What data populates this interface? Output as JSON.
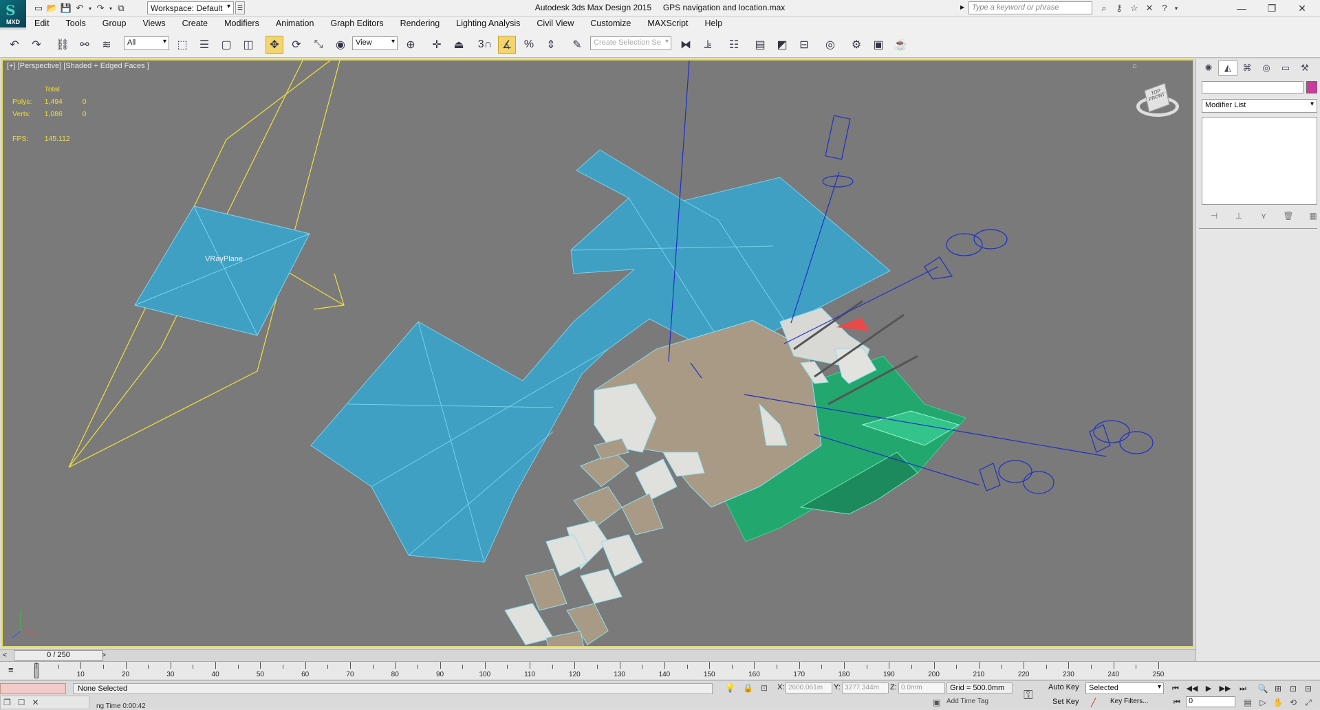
{
  "app": {
    "title": "Autodesk 3ds Max Design 2015",
    "file": "GPS navigation and location.max",
    "logo_text": "MXD",
    "workspace": "Workspace: Default",
    "search_placeholder": "Type a keyword or phrase"
  },
  "menu": [
    "Edit",
    "Tools",
    "Group",
    "Views",
    "Create",
    "Modifiers",
    "Animation",
    "Graph Editors",
    "Rendering",
    "Lighting Analysis",
    "Civil View",
    "Customize",
    "MAXScript",
    "Help"
  ],
  "toolbar": {
    "filter_select": "All",
    "coord_select": "View",
    "selection_set": "Create Selection Se",
    "snap_label": "3"
  },
  "viewport": {
    "label": "[+] [Perspective] [Shaded + Edged Faces ]",
    "stats": {
      "header": "Total",
      "polys_label": "Polys:",
      "polys_value": "1,494",
      "polys_sel": "0",
      "verts_label": "Verts:",
      "verts_value": "1,086",
      "verts_sel": "0",
      "fps_label": "FPS:",
      "fps_value": "145.112"
    },
    "object_label": "VRayPlane",
    "viewcube_top": "TOP",
    "viewcube_front": "FRONT",
    "colors": {
      "background": "#7a7a7a",
      "plane_blue": "#3fa0c4",
      "green_area": "#22a86f",
      "building": "#a89a84",
      "light_building": "#e0e0dc",
      "camera_blue": "#1e2fc8",
      "light_yellow": "#f3e23a",
      "target_red": "#e84a4a",
      "active_border": "#e9e043"
    }
  },
  "command_panel": {
    "modifier_list": "Modifier List",
    "object_color": "#cc3aa0"
  },
  "time": {
    "frame_display": "0 / 250",
    "ruler_labels": [
      "0",
      "10",
      "20",
      "30",
      "40",
      "50",
      "60",
      "70",
      "80",
      "90",
      "100",
      "110",
      "120",
      "130",
      "140",
      "150",
      "160",
      "170",
      "180",
      "190",
      "200",
      "210",
      "220",
      "230",
      "240",
      "250"
    ]
  },
  "status": {
    "selection": "None Selected",
    "x_label": "X:",
    "x_value": "2600.061m",
    "y_label": "Y:",
    "y_value": "3277.344m",
    "z_label": "Z:",
    "z_value": "0.0mm",
    "grid": "Grid = 500.0mm",
    "add_time_tag": "Add Time Tag",
    "auto_key": "Auto Key",
    "set_key": "Set Key",
    "selected_dropdown": "Selected",
    "key_filters": "Key Filters...",
    "frame_input": "0",
    "render_time": "ng Time  0:00:42"
  }
}
